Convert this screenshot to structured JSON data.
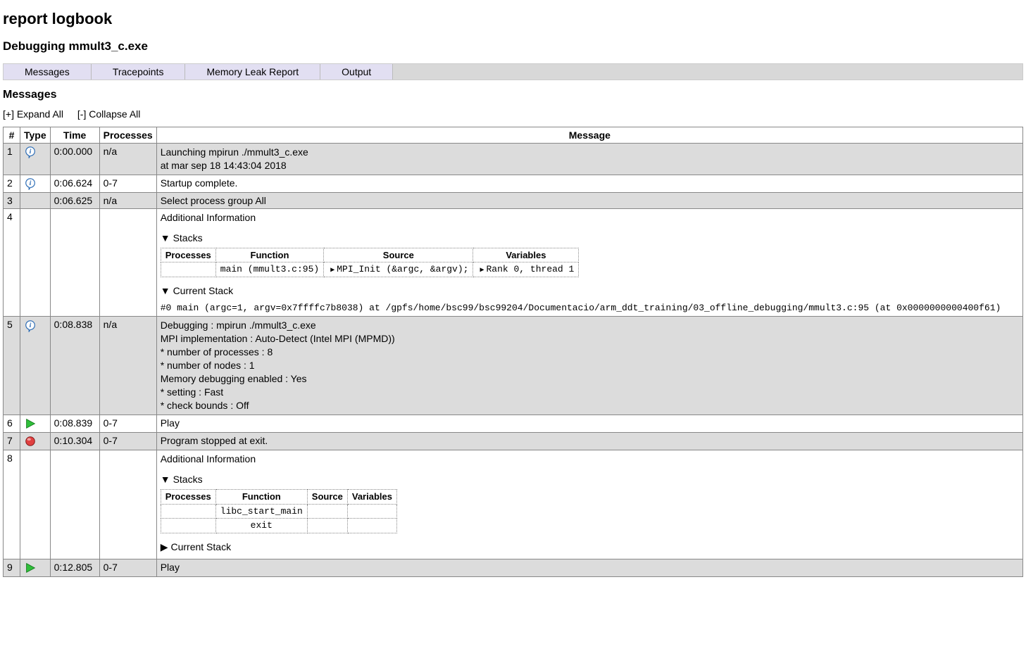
{
  "title": "report logbook",
  "subtitle": "Debugging mmult3_c.exe",
  "tabs": [
    "Messages",
    "Tracepoints",
    "Memory Leak Report",
    "Output"
  ],
  "section_heading": "Messages",
  "expand_all": "[+] Expand All",
  "collapse_all": "[-] Collapse All",
  "columns": {
    "num": "#",
    "type": "Type",
    "time": "Time",
    "processes": "Processes",
    "message": "Message"
  },
  "rows": {
    "r1": {
      "num": "1",
      "time": "0:00.000",
      "processes": "n/a",
      "msg_l1": "Launching mpirun ./mmult3_c.exe",
      "msg_l2": "at mar sep 18 14:43:04 2018"
    },
    "r2": {
      "num": "2",
      "time": "0:06.624",
      "processes": "0-7",
      "msg": "Startup complete."
    },
    "r3": {
      "num": "3",
      "time": "0:06.625",
      "processes": "n/a",
      "msg": "Select process group All"
    },
    "r4": {
      "num": "4",
      "additional_info": "Additional Information",
      "stacks_label": "Stacks",
      "stacks_headers": {
        "processes": "Processes",
        "function": "Function",
        "source": "Source",
        "variables": "Variables"
      },
      "stacks_row": {
        "processes": "",
        "function": "main (mmult3.c:95)",
        "source": "MPI_Init (&argc, &argv);",
        "variables": "Rank 0, thread 1"
      },
      "current_stack_label": "Current Stack",
      "current_stack_line": "#0 main (argc=1, argv=0x7ffffc7b8038) at /gpfs/home/bsc99/bsc99204/Documentacio/arm_ddt_training/03_offline_debugging/mmult3.c:95 (at 0x0000000000400f61)"
    },
    "r5": {
      "num": "5",
      "time": "0:08.838",
      "processes": "n/a",
      "l1": "Debugging : mpirun ./mmult3_c.exe",
      "l2": "MPI implementation : Auto-Detect (Intel MPI (MPMD))",
      "l3": "* number of processes : 8",
      "l4": "* number of nodes : 1",
      "l5": "Memory debugging enabled : Yes",
      "l6": "* setting : Fast",
      "l7": "* check bounds : Off"
    },
    "r6": {
      "num": "6",
      "time": "0:08.839",
      "processes": "0-7",
      "msg": "Play"
    },
    "r7": {
      "num": "7",
      "time": "0:10.304",
      "processes": "0-7",
      "msg": "Program stopped at exit."
    },
    "r8": {
      "num": "8",
      "additional_info": "Additional Information",
      "stacks_label": "Stacks",
      "stacks_headers": {
        "processes": "Processes",
        "function": "Function",
        "source": "Source",
        "variables": "Variables"
      },
      "stacks_rows": {
        "r1_function": "libc_start_main",
        "r2_function": "exit"
      },
      "current_stack_label": "Current Stack"
    },
    "r9": {
      "num": "9",
      "time": "0:12.805",
      "processes": "0-7",
      "msg": "Play"
    }
  }
}
